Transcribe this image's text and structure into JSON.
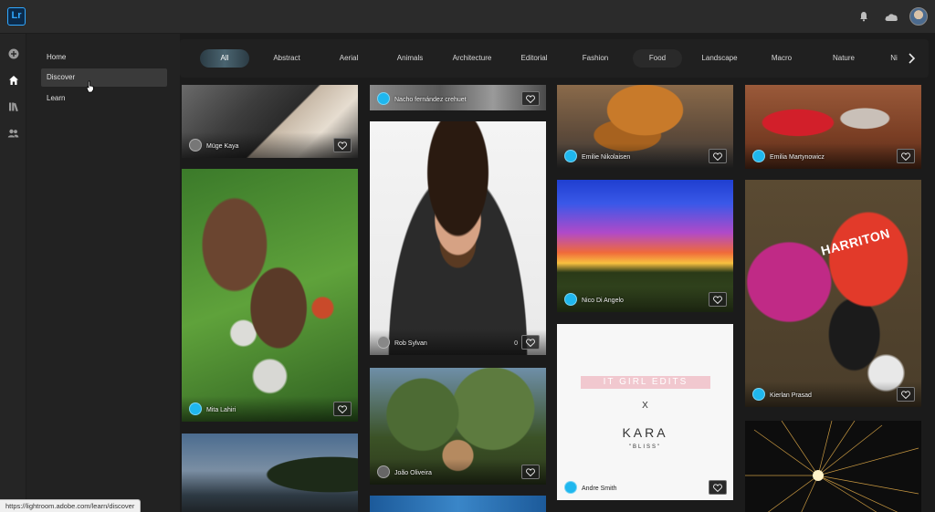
{
  "app": {
    "logo_text": "Lr"
  },
  "topbar": {
    "icons": [
      "bell-icon",
      "cloud-icon",
      "profile-avatar"
    ]
  },
  "rail": {
    "icons": [
      "add-icon",
      "home-icon",
      "library-icon",
      "people-icon"
    ]
  },
  "sidenav": {
    "items": [
      {
        "label": "Home"
      },
      {
        "label": "Discover",
        "active": true
      },
      {
        "label": "Learn"
      }
    ]
  },
  "categories": {
    "items": [
      "All",
      "Abstract",
      "Aerial",
      "Animals",
      "Architecture",
      "Editorial",
      "Fashion",
      "Food",
      "Landscape",
      "Macro",
      "Nature",
      "Ni"
    ],
    "active": "All"
  },
  "tiles": {
    "t1": {
      "author": "Müge Kaya"
    },
    "t2": {
      "author": "Mita Lahiri"
    },
    "t4": {
      "author": "Nacho fernández crehuet"
    },
    "t5": {
      "author": "Rob Sylvan",
      "likes": "0"
    },
    "t6": {
      "author": "João Oliveira"
    },
    "t8": {
      "author": "Emilie Nikolaisen"
    },
    "t9": {
      "author": "Nico Di Angelo"
    },
    "t10": {
      "author": "Andre Smith",
      "line1": "IT GIRL EDITS",
      "line2": "X",
      "line3": "KARA",
      "line4": "\"BLISS\""
    },
    "t11": {
      "author": "Emilia Martynowicz"
    },
    "t12": {
      "author": "Kierlan Prasad",
      "jersey_text": "HARRITON"
    }
  },
  "status": {
    "url": "https://lightroom.adobe.com/learn/discover"
  },
  "colors": {
    "accent": "#31a8ff",
    "avatar_blue": "#1fb7ee"
  }
}
